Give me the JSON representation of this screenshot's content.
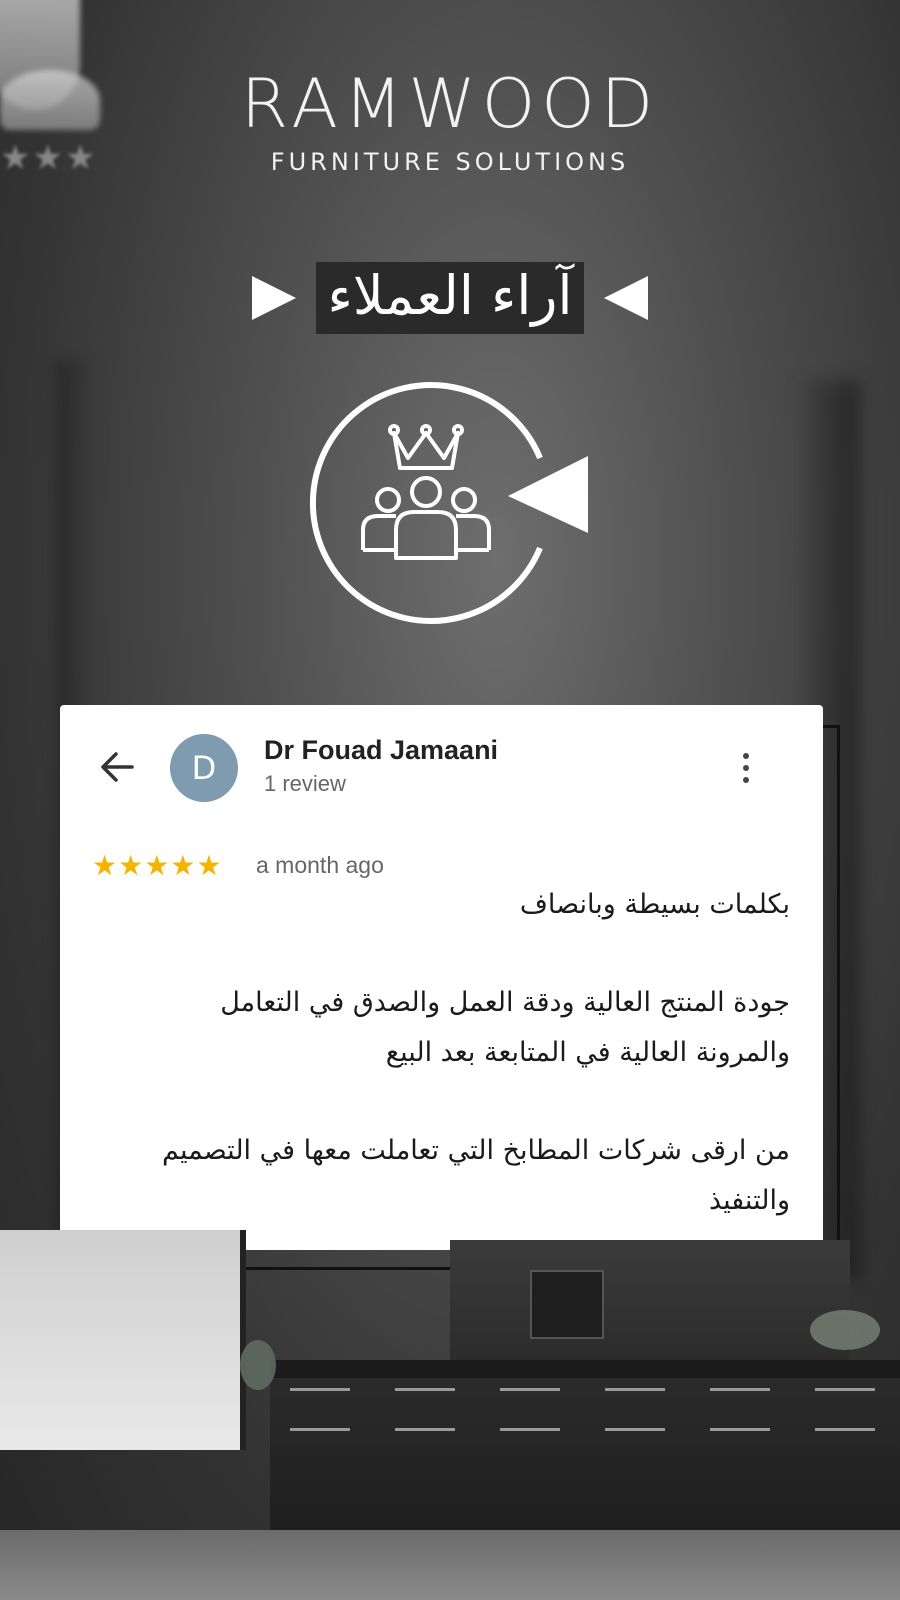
{
  "brand": {
    "name": "RAMWOOD",
    "tagline": "FURNITURE SOLUTIONS"
  },
  "heading": {
    "title": "آراء العملاء"
  },
  "review": {
    "avatar_initial": "D",
    "reviewer_name": "Dr Fouad Jamaani",
    "review_count": "1 review",
    "rating_stars": 5,
    "stars_display": "★★★★★",
    "time_ago": "a month ago",
    "paragraphs": [
      "بكلمات بسيطة وبانصاف",
      "جودة المنتج العالية ودقة العمل والصدق في التعامل والمرونة العالية في المتابعة بعد البيع",
      "من ارقى شركات المطابخ التي تعاملت معها في التصميم والتنفيذ"
    ]
  },
  "background": {
    "stars_display": "★★★"
  },
  "colors": {
    "star": "#f4b400",
    "avatar": "#7f9bb0",
    "heading_box": "#2a2a2a"
  },
  "icons": {
    "back": "arrow-left-icon",
    "more": "more-vertical-icon",
    "emblem": "customers-crown-icon"
  }
}
